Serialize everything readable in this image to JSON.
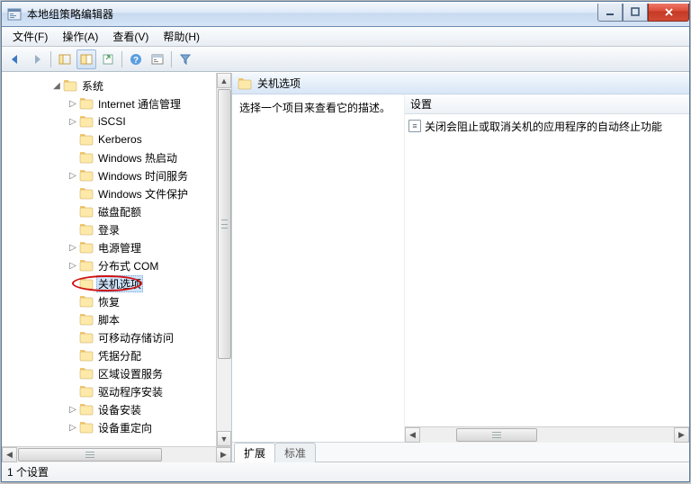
{
  "window": {
    "title": "本地组策略编辑器"
  },
  "menu": {
    "file": "文件(F)",
    "action": "操作(A)",
    "view": "查看(V)",
    "help": "帮助(H)"
  },
  "tree": {
    "root": "系统",
    "items": [
      {
        "label": "Internet 通信管理",
        "expandable": true
      },
      {
        "label": "iSCSI",
        "expandable": true
      },
      {
        "label": "Kerberos",
        "expandable": false
      },
      {
        "label": "Windows 热启动",
        "expandable": false
      },
      {
        "label": "Windows 时间服务",
        "expandable": true
      },
      {
        "label": "Windows 文件保护",
        "expandable": false
      },
      {
        "label": "磁盘配额",
        "expandable": false
      },
      {
        "label": "登录",
        "expandable": false
      },
      {
        "label": "电源管理",
        "expandable": true
      },
      {
        "label": "分布式 COM",
        "expandable": true
      },
      {
        "label": "关机选项",
        "expandable": false,
        "selected": true,
        "circled": true
      },
      {
        "label": "恢复",
        "expandable": false
      },
      {
        "label": "脚本",
        "expandable": false
      },
      {
        "label": "可移动存储访问",
        "expandable": false
      },
      {
        "label": "凭据分配",
        "expandable": false
      },
      {
        "label": "区域设置服务",
        "expandable": false
      },
      {
        "label": "驱动程序安装",
        "expandable": false
      },
      {
        "label": "设备安装",
        "expandable": true
      },
      {
        "label": "设备重定向",
        "expandable": true
      }
    ]
  },
  "detail": {
    "title": "关机选项",
    "description": "选择一个项目来查看它的描述。",
    "column": "设置",
    "items": [
      "关闭会阻止或取消关机的应用程序的自动终止功能"
    ]
  },
  "tabs": {
    "extended": "扩展",
    "standard": "标准"
  },
  "status": "1 个设置"
}
